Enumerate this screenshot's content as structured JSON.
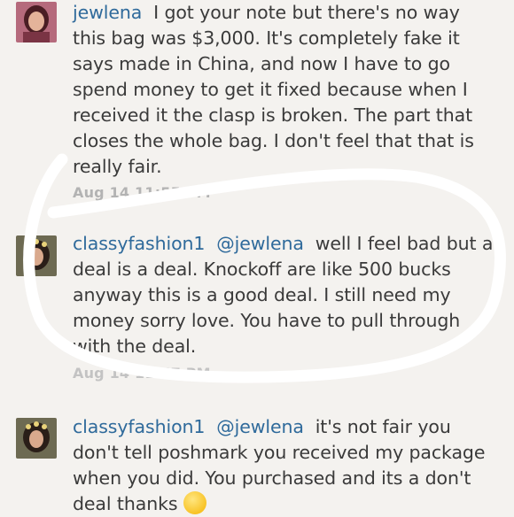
{
  "comments": [
    {
      "username": "jewlena",
      "mention": "",
      "text": "I got your note but there's no way this bag was $3,000. It's completely fake it says made in China, and now I have to go spend money to get it fixed because when I received it the clasp is broken. The part that closes the whole bag. I don't feel that that is really fair.",
      "timestamp": "Aug 14 11:55 PM"
    },
    {
      "username": "classyfashion1",
      "mention": "@jewlena",
      "text": "well I feel bad but a deal is a deal. Knockoff are like 500 bucks anyway this is a good deal. I still need my money sorry love. You have to pull through with the deal.",
      "timestamp": "Aug 14 11:57 PM"
    },
    {
      "username": "classyfashion1",
      "mention": "@jewlena",
      "text": "it's not fair you don't tell poshmark you received my package when you did. You purchased and its a don't deal thanks",
      "emoji": "smiling-emoji"
    }
  ],
  "colors": {
    "username": "#2f6a9b",
    "text": "#3a3a3a",
    "timestamp": "#b3b3b3",
    "background": "#f4f2ef",
    "highlight": "#ffffff"
  }
}
